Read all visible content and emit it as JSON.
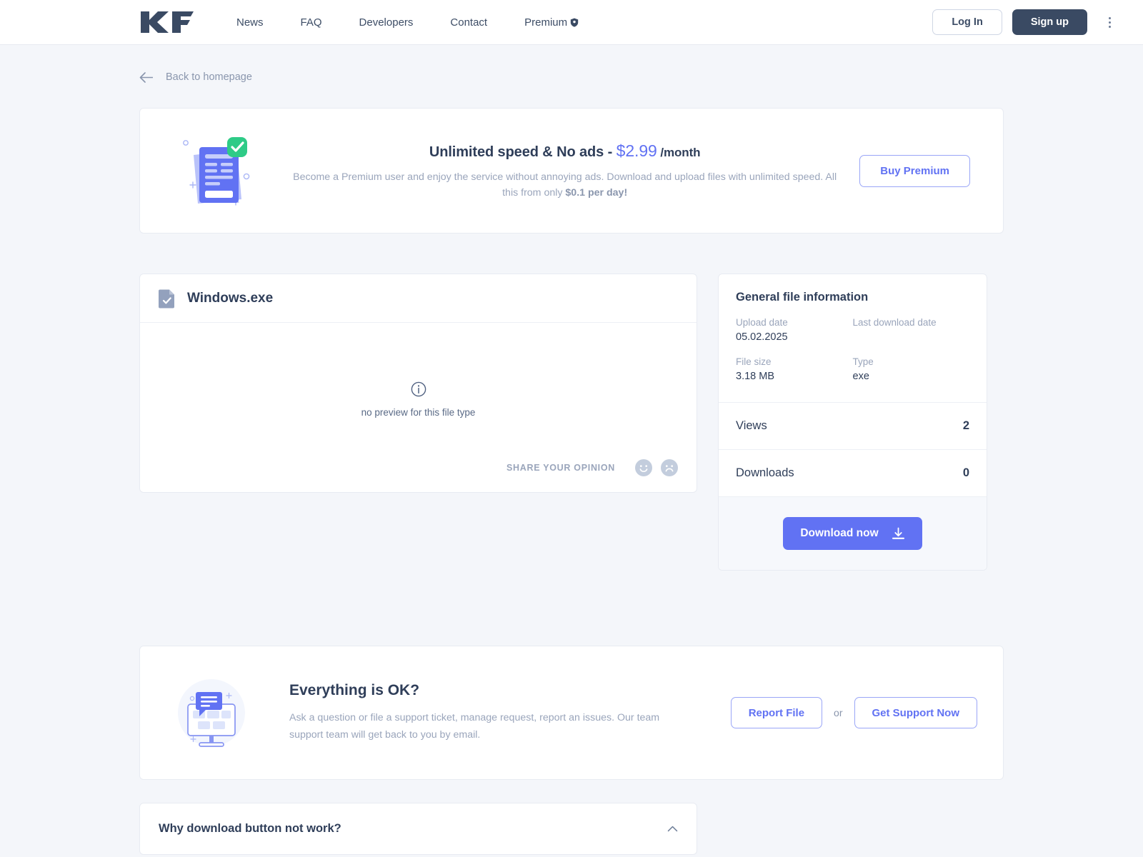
{
  "header": {
    "logo_alt": "KF",
    "nav": [
      {
        "label": "News",
        "icon": null
      },
      {
        "label": "FAQ",
        "icon": null
      },
      {
        "label": "Developers",
        "icon": null
      },
      {
        "label": "Contact",
        "icon": null
      },
      {
        "label": "Premium",
        "icon": "shield-badge-icon"
      }
    ],
    "login_label": "Log In",
    "signup_label": "Sign up",
    "menu_icon": "kebab-menu-icon"
  },
  "back_link": {
    "label": "Back to homepage",
    "icon": "arrow-left-icon"
  },
  "promo": {
    "illustration": "document-check-illustration",
    "title_prefix": "Unlimited speed & No ads - ",
    "price": "$2.99",
    "period": " /month",
    "description_part1": "Become a Premium user and enjoy the service without annoying ads. Download and upload files with unlimited speed. All this from only ",
    "description_bold": "$0.1 per day!",
    "buy_label": "Buy Premium"
  },
  "file": {
    "icon": "file-check-icon",
    "name": "Windows.exe",
    "preview_icon": "info-circle-icon",
    "preview_note": "no preview for this file type",
    "opinion_label": "SHARE YOUR OPINION",
    "opinion_positive_icon": "smiley-happy-icon",
    "opinion_negative_icon": "smiley-sad-icon"
  },
  "info": {
    "title": "General file information",
    "pairs": [
      [
        {
          "label": "Upload date",
          "value": "05.02.2025"
        },
        {
          "label": "Last download date",
          "value": ""
        }
      ],
      [
        {
          "label": "File size",
          "value": "3.18 MB"
        },
        {
          "label": "Type",
          "value": "exe"
        }
      ]
    ],
    "stats": [
      {
        "name": "Views",
        "value": "2"
      },
      {
        "name": "Downloads",
        "value": "0"
      }
    ],
    "download_label": "Download now",
    "download_icon": "download-icon"
  },
  "support": {
    "illustration": "monitor-chat-illustration",
    "title": "Everything is OK?",
    "description": "Ask a question or file a support ticket, manage request, report an issues. Our team support team will get back to you by email.",
    "report_label": "Report File",
    "or_label": "or",
    "support_label": "Get Support Now"
  },
  "faq": {
    "items": [
      {
        "question": "Why download button not work?",
        "toggle_icon": "chevron-up-icon"
      }
    ]
  },
  "colors": {
    "accent": "#6172f3",
    "dark": "#3a4a63",
    "muted": "#9aa5bb",
    "page_bg": "#f4f6fa",
    "success": "#2ecb87"
  }
}
